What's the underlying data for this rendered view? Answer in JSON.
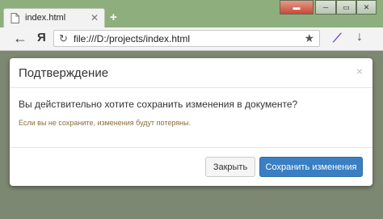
{
  "browser": {
    "tab_title": "index.html",
    "new_tab": "+",
    "back": "←",
    "logo": "Я",
    "reload": "↻",
    "url": "file:///D:/projects/index.html",
    "star": "★",
    "download": "↓"
  },
  "modal": {
    "title": "Подтверждение",
    "close": "×",
    "message": "Вы действительно хотите сохранить изменения в документе?",
    "warning": "Если вы не сохраните, изменения будут потеряны.",
    "close_button": "Закрыть",
    "save_button": "Сохранить изменения"
  },
  "colors": {
    "primary": "#3a7fc3",
    "warning_text": "#8a6d3b"
  }
}
